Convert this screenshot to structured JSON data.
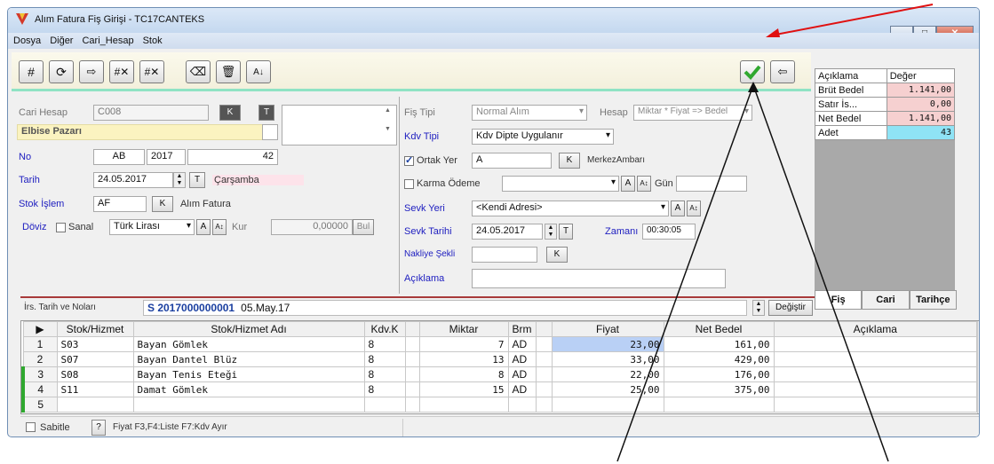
{
  "window": {
    "title": "Alım Fatura Fiş Girişi - TC17CANTEKS"
  },
  "menu": [
    "Dosya",
    "Diğer",
    "Cari_Hesap",
    "Stok"
  ],
  "left_form": {
    "cari_hesap_label": "Cari Hesap",
    "cari_hesap_value": "C008",
    "k_btn": "K",
    "t_btn": "T",
    "cari_name": "Elbise Pazarı",
    "no_label": "No",
    "no_prefix": "AB",
    "no_year": "2017",
    "no_value": "42",
    "tarih_label": "Tarih",
    "tarih_value": "24.05.2017",
    "tarih_t_btn": "T",
    "tarih_day": "Çarşamba",
    "stok_islem_label": "Stok İşlem",
    "stok_islem_value": "AF",
    "stok_k_btn": "K",
    "stok_islem_desc": "Alım Fatura",
    "doviz_label": "Döviz",
    "sanal_label": "Sanal",
    "doviz_value": "Türk Lirası",
    "a_btn": "A",
    "kur_label": "Kur",
    "kur_value": "0,00000",
    "bul_btn": "Bul"
  },
  "mid_form": {
    "fis_tipi_label": "Fiş Tipi",
    "fis_tipi_value": "Normal Alım",
    "hesap_label": "Hesap",
    "hesap_value": "Miktar * Fiyat => Bedel",
    "kdv_tipi_label": "Kdv Tipi",
    "kdv_tipi_value": "Kdv Dipte Uygulanır",
    "ortak_yer_label": "Ortak Yer",
    "ortak_yer_value": "A",
    "ortak_k_btn": "K",
    "ortak_desc": "MerkezAmbarı",
    "karma_odeme_label": "Karma Ödeme",
    "karma_a_btn": "A",
    "gun_label": "Gün",
    "sevk_yeri_label": "Sevk Yeri",
    "sevk_yeri_value": "<Kendi Adresi>",
    "sevk_a_btn": "A",
    "sevk_tarihi_label": "Sevk Tarihi",
    "sevk_tarihi_value": "24.05.2017",
    "sevk_t_btn": "T",
    "zamani_label": "Zamanı",
    "zamani_value": "00:30:05",
    "nakliye_label": "Nakliye Şekli",
    "nakliye_k_btn": "K",
    "aciklama_label": "Açıklama"
  },
  "summary": {
    "headers": [
      "Açıklama",
      "Değer"
    ],
    "rows": [
      {
        "label": "Brüt Bedel",
        "value": "1.141,00",
        "color": "#f6d0d0"
      },
      {
        "label": "Satır İs...",
        "value": "0,00",
        "color": "#f6d0d0"
      },
      {
        "label": "Net Bedel",
        "value": "1.141,00",
        "color": "#f6d0d0"
      },
      {
        "label": "Adet",
        "value": "43",
        "color": "#8fe3f5"
      }
    ]
  },
  "tabs": [
    "Fiş",
    "Cari",
    "Tarihçe"
  ],
  "irs": {
    "label": "İrs. Tarih ve Noları",
    "value": "S 2017000000001",
    "date": "05.May.17",
    "degistir_btn": "Değiştir"
  },
  "grid": {
    "headers": [
      "Stok/Hizmet",
      "Stok/Hizmet Adı",
      "Kdv.K",
      "Miktar",
      "Brm",
      "Fiyat",
      "Net Bedel",
      "Açıklama"
    ],
    "rows": [
      {
        "n": "1",
        "code": "S03",
        "name": "Bayan Gömlek",
        "kdv": "8",
        "miktar": "7",
        "brm": "AD",
        "fiyat": "23,00",
        "net": "161,00"
      },
      {
        "n": "2",
        "code": "S07",
        "name": "Bayan Dantel Blüz",
        "kdv": "8",
        "miktar": "13",
        "brm": "AD",
        "fiyat": "33,00",
        "net": "429,00"
      },
      {
        "n": "3",
        "code": "S08",
        "name": "Bayan Tenis Eteği",
        "kdv": "8",
        "miktar": "8",
        "brm": "AD",
        "fiyat": "22,00",
        "net": "176,00"
      },
      {
        "n": "4",
        "code": "S11",
        "name": "Damat Gömlek",
        "kdv": "8",
        "miktar": "15",
        "brm": "AD",
        "fiyat": "25,00",
        "net": "375,00"
      },
      {
        "n": "5",
        "code": "",
        "name": "",
        "kdv": "",
        "miktar": "",
        "brm": "",
        "fiyat": "",
        "net": ""
      }
    ]
  },
  "status": {
    "sabitle_label": "Sabitle",
    "help_btn": "?",
    "hint": "Fiyat F3,F4:Liste F7:Kdv Ayır"
  },
  "colors": {
    "accent_green": "#2fa82f",
    "highlight_blue": "#b9d0f5",
    "name_yellow": "#fbf3c0"
  }
}
